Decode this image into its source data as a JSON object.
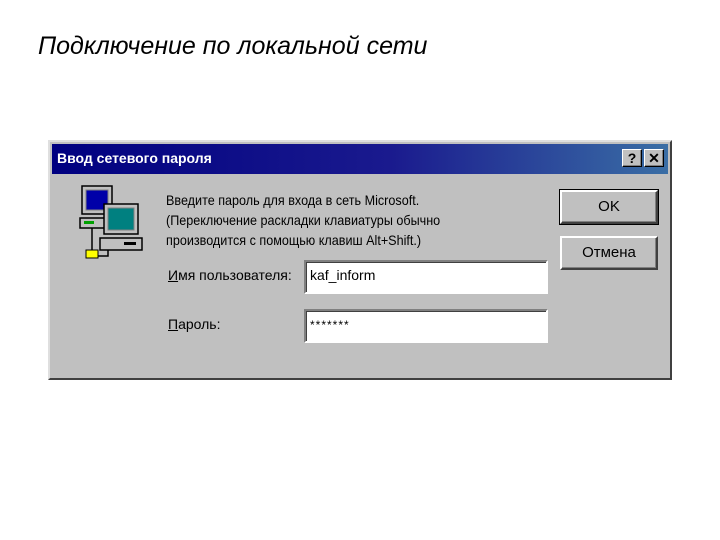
{
  "slide": {
    "title": "Подключение по локальной сети"
  },
  "dialog": {
    "title": "Ввод сетевого пароля",
    "help_label": "?",
    "close_label": "✕",
    "message_lines": [
      "Введите пароль для входа в сеть Microsoft.",
      "(Переключение раскладки клавиатуры обычно",
      "производится с помощью клавиш Alt+Shift.)"
    ],
    "username_label_hotkey": "И",
    "username_label_rest": "мя пользователя:",
    "username_value": "kaf_inform",
    "password_label_hotkey": "П",
    "password_label_rest": "ароль:",
    "password_value": "*******",
    "ok_label": "OK",
    "cancel_label": "Отмена",
    "icon": "network-computers-icon",
    "colors": {
      "titlebar_start": "#000080",
      "titlebar_end": "#3a6ea5",
      "face": "#c0c0c0"
    }
  }
}
